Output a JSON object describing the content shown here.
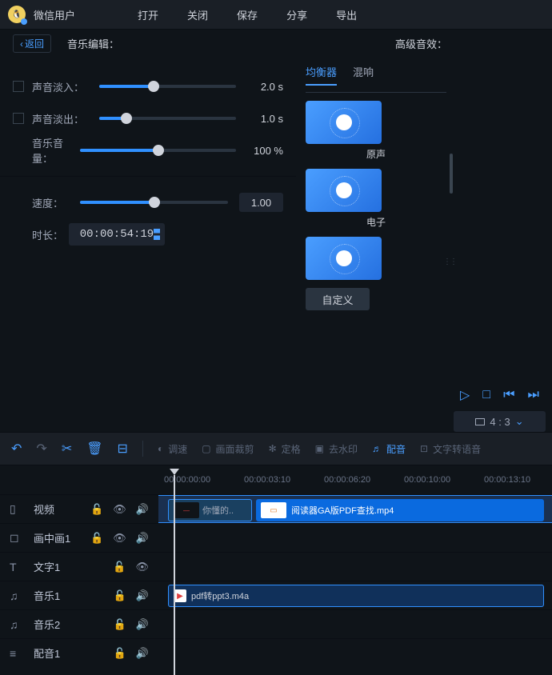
{
  "header": {
    "username": "微信用户",
    "menu": [
      "打开",
      "关闭",
      "保存",
      "分享",
      "导出"
    ]
  },
  "editor": {
    "back": "返回",
    "title": "音乐编辑：",
    "effects_title": "高级音效：",
    "fade_in_label": "声音淡入：",
    "fade_in_value": "2.0 s",
    "fade_out_label": "声音淡出：",
    "fade_out_value": "1.0 s",
    "volume_label": "音乐音量：",
    "volume_value": "100 %",
    "speed_label": "速度：",
    "speed_value": "1.00",
    "duration_label": "时长：",
    "duration_value": "00:00:54:19"
  },
  "effects": {
    "tabs": [
      "均衡器",
      "混响"
    ],
    "presets": [
      "原声",
      "电子",
      ""
    ],
    "custom": "自定义"
  },
  "playback": {
    "aspect": "4 : 3"
  },
  "toolbar": {
    "speed": "调速",
    "crop": "画面裁剪",
    "freeze": "定格",
    "watermark": "去水印",
    "dub": "配音",
    "tts": "文字转语音"
  },
  "timeline": {
    "marks": [
      "00:00:00:00",
      "00:00:03:10",
      "00:00:06:20",
      "00:00:10:00",
      "00:00:13:10"
    ],
    "tracks": {
      "video": "视频",
      "pip": "画中画1",
      "text": "文字1",
      "music1": "音乐1",
      "music2": "音乐2",
      "dub": "配音1"
    },
    "clips": {
      "video1": "你懂的..",
      "video2": "阅读器GA版PDF查找.mp4",
      "audio1": "pdf转ppt3.m4a"
    }
  }
}
